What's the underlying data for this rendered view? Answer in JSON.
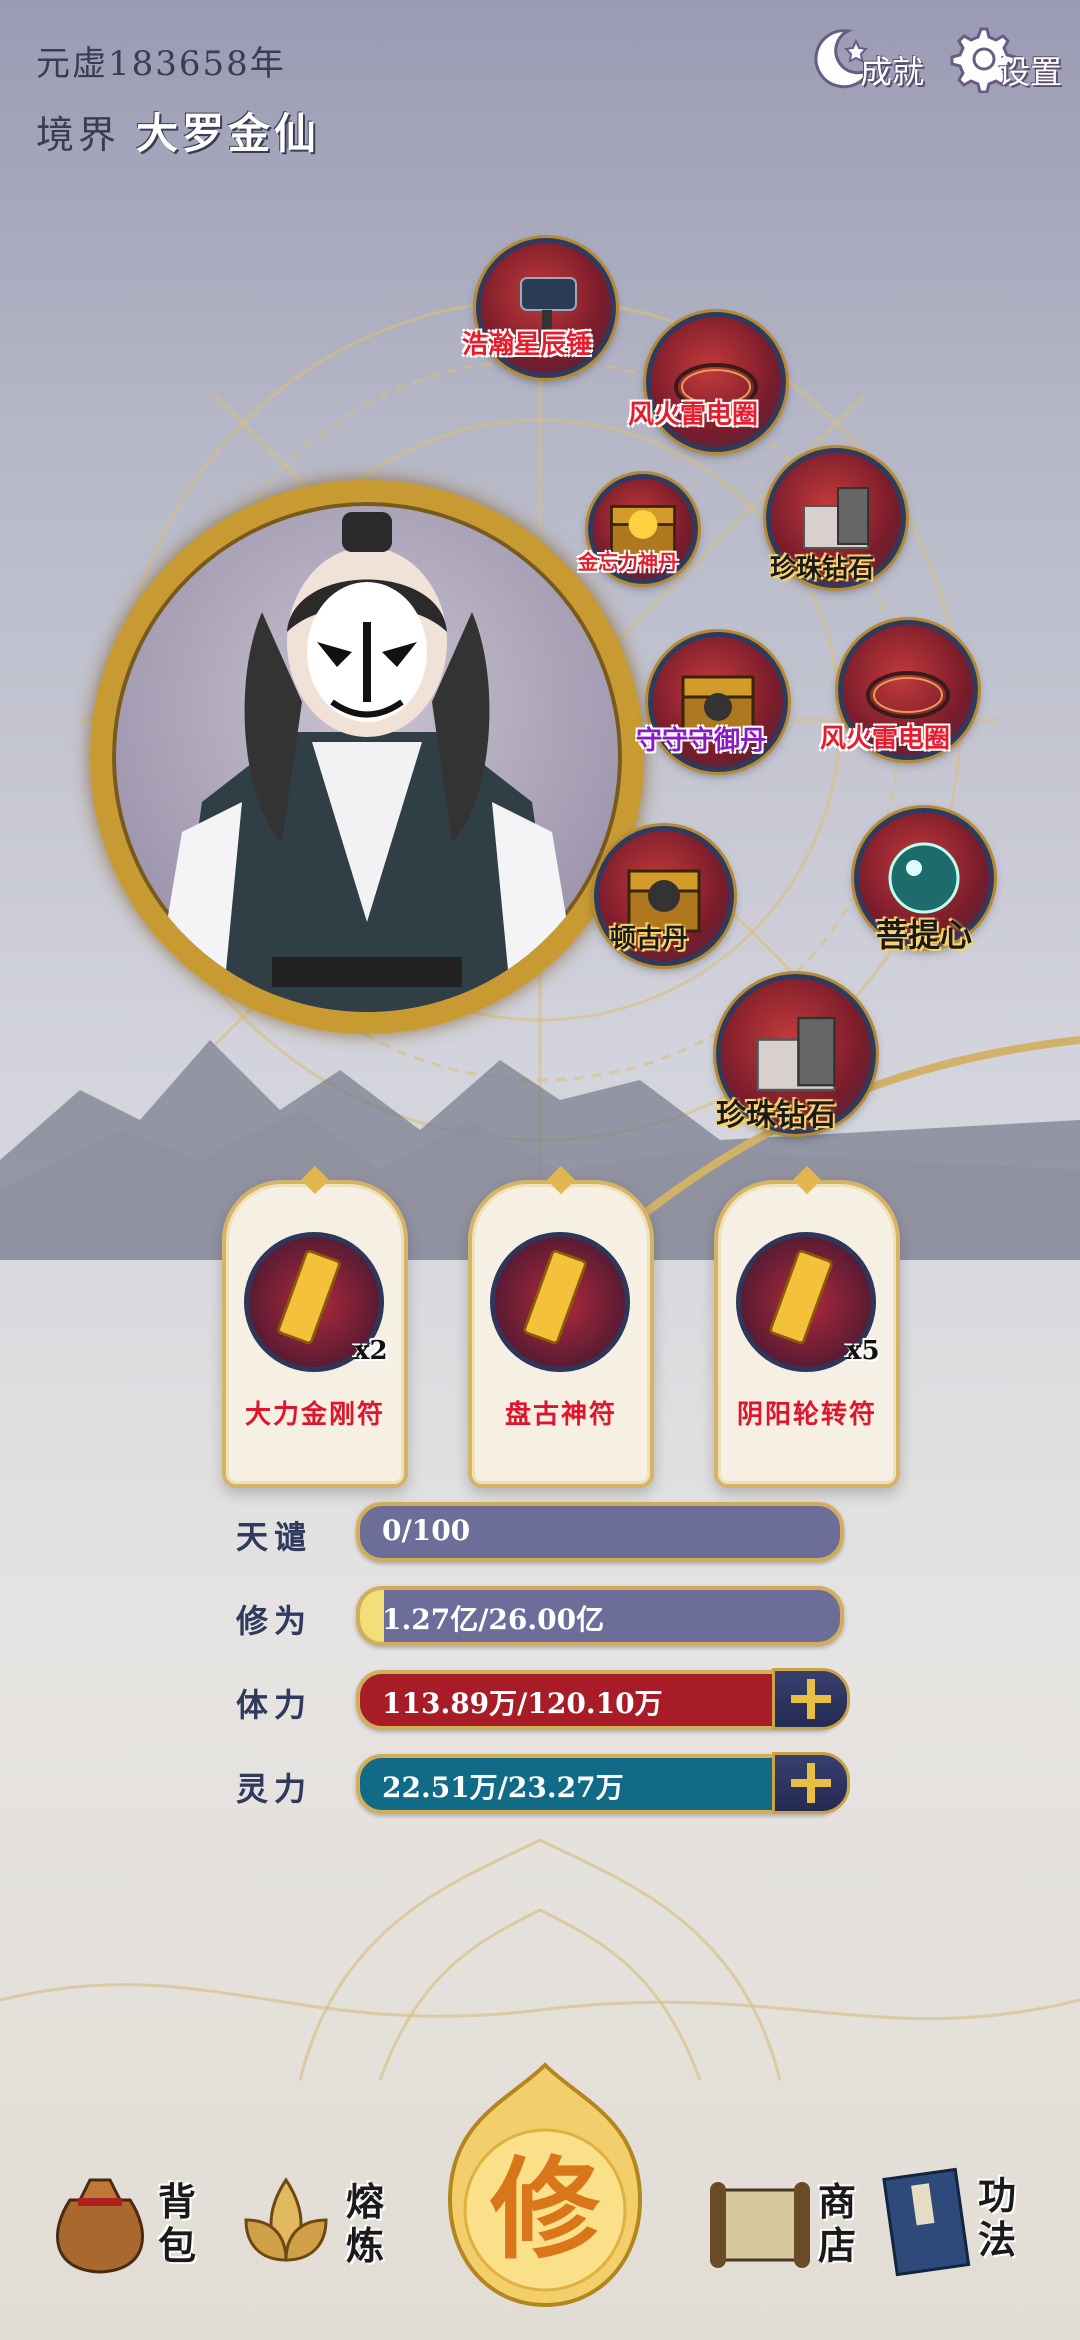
{
  "header": {
    "era_text": "元虚183658年",
    "realm_label": "境界",
    "realm_value": "大罗金仙",
    "achievements_label": "成就",
    "settings_label": "设置"
  },
  "equipment": [
    {
      "name": "浩瀚星辰锤",
      "icon": "hammer-icon"
    },
    {
      "name": "风火雷电圈",
      "icon": "ring-icon"
    },
    {
      "name": "金忘力神丹",
      "icon": "chest-icon"
    },
    {
      "name": "珍珠钻石",
      "icon": "gem-box-icon"
    },
    {
      "name": "守守守御丹",
      "icon": "chest-icon"
    },
    {
      "name": "风火雷电圈",
      "icon": "ring-icon"
    },
    {
      "name": "顿古丹",
      "icon": "chest-icon"
    },
    {
      "name": "菩提心",
      "icon": "orb-icon"
    },
    {
      "name": "珍珠钻石",
      "icon": "gem-box-icon"
    }
  ],
  "talismans": [
    {
      "name": "大力金刚符",
      "qty": "x2"
    },
    {
      "name": "盘古神符",
      "qty": ""
    },
    {
      "name": "阴阳轮转符",
      "qty": "x5"
    }
  ],
  "stats": {
    "tianqian": {
      "label": "天谴",
      "text": "0/100",
      "fill": 0.0
    },
    "xiuwei": {
      "label": "修为",
      "text": "1.27亿/26.00亿",
      "fill": 0.049
    },
    "tili": {
      "label": "体力",
      "text": "113.89万/120.10万",
      "fill": 0.948
    },
    "lingli": {
      "label": "灵力",
      "text": "22.51万/23.27万",
      "fill": 0.967
    }
  },
  "nav": {
    "bag": "背包",
    "smelt": "熔炼",
    "cultivate": "修",
    "shop": "商店",
    "skills": "功法"
  },
  "colors": {
    "gold": "#c79a32",
    "xiuwei_fill": "#f3df7a",
    "tili_fill": "#a81c28",
    "lingli_fill": "#116b86",
    "bar_bg": "#6c6e99"
  }
}
